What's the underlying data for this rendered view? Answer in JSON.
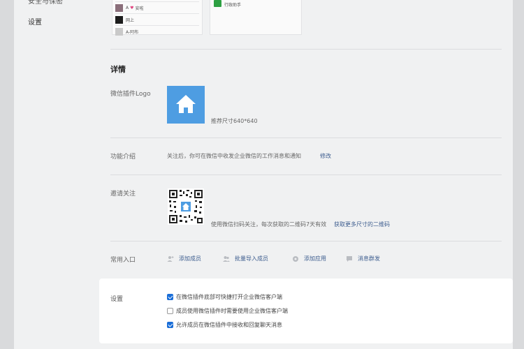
{
  "sidebar": {
    "items": [
      {
        "label": "安全与保密"
      },
      {
        "label": "设置"
      }
    ]
  },
  "preview": {
    "members": [
      {
        "label": "A"
      },
      {
        "label": "网上"
      },
      {
        "label": "A-阿布"
      }
    ],
    "member_extra": "安啦",
    "app_label": "行政助手"
  },
  "details": {
    "title": "详情",
    "logo_label": "微信插件Logo",
    "logo_hint": "推荐尺寸640*640",
    "intro_label": "功能介绍",
    "intro_text": "关注后，你可在微信中收发企业微信的工作消息和通知",
    "intro_edit": "修改",
    "invite_label": "邀请关注",
    "invite_text": "使用微信扫码关注，每次获取的二维码7天有效",
    "invite_link": "获取更多尺寸的二维码",
    "shortcuts_label": "常用入口",
    "shortcuts": [
      {
        "label": "添加成员",
        "icon": "add-user-icon"
      },
      {
        "label": "批量导入成员",
        "icon": "users-icon"
      },
      {
        "label": "添加应用",
        "icon": "app-icon"
      },
      {
        "label": "消息群发",
        "icon": "message-icon"
      }
    ]
  },
  "settings": {
    "label": "设置",
    "options": [
      {
        "label": "在微信插件底部可快捷打开企业微信客户端",
        "checked": true
      },
      {
        "label": "成员使用微信插件时需要使用企业微信客户端",
        "checked": false
      },
      {
        "label": "允许成员在微信插件中接收和回复聊天消息",
        "checked": true
      }
    ]
  },
  "colors": {
    "accent": "#1a6ed8",
    "link": "#3d5d8f",
    "logo_bg": "#4e9de2"
  }
}
